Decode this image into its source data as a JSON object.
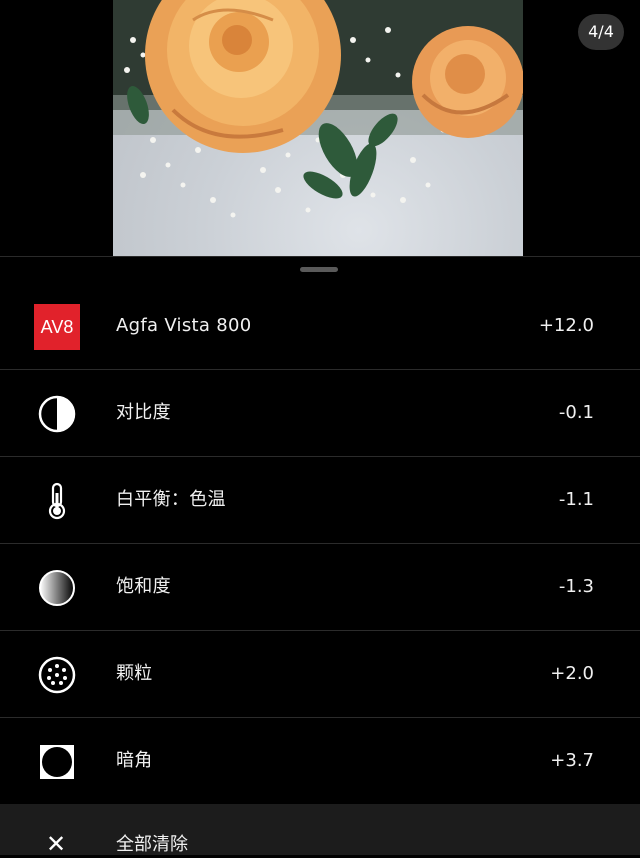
{
  "page_counter": "4/4",
  "adjustments": [
    {
      "name": "Agfa Vista 800",
      "value": "+12.0",
      "icon": "film-preset-badge",
      "badge": "AV8",
      "badge_color": "#e1222b"
    },
    {
      "name": "对比度",
      "value": "-0.1",
      "icon": "contrast-icon"
    },
    {
      "name": "白平衡：色温",
      "value": "-1.1",
      "icon": "thermometer-icon"
    },
    {
      "name": "饱和度",
      "value": "-1.3",
      "icon": "saturation-icon"
    },
    {
      "name": "颗粒",
      "value": "+2.0",
      "icon": "grain-icon"
    },
    {
      "name": "暗角",
      "value": "+3.7",
      "icon": "vignette-icon"
    }
  ],
  "clear_all": {
    "label": "全部清除",
    "icon": "close-icon"
  }
}
